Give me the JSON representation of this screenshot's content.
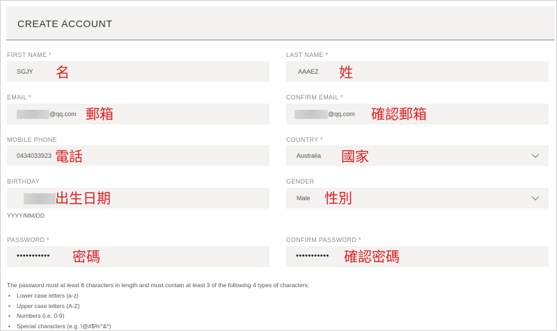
{
  "header": {
    "title": "CREATE ACCOUNT"
  },
  "fields": {
    "first_name": {
      "label": "FIRST NAME *",
      "value": "SGJY",
      "annotation": "名"
    },
    "last_name": {
      "label": "LAST NAME *",
      "value": "AAAEZ",
      "annotation": "姓"
    },
    "email": {
      "label": "EMAIL *",
      "value_suffix": "@qq.com",
      "annotation": "郵箱"
    },
    "confirm_email": {
      "label": "CONFIRM EMAIL *",
      "value_suffix": "@qq.com",
      "annotation": "確認郵箱"
    },
    "mobile_phone": {
      "label": "MOBILE PHONE",
      "value": "0434033923",
      "annotation": "電話"
    },
    "country": {
      "label": "COUNTRY *",
      "value": "Australia",
      "annotation": "國家"
    },
    "birthday": {
      "label": "BIRTHDAY",
      "hint": "YYYY/MM/DD",
      "annotation": "出生日期"
    },
    "gender": {
      "label": "GENDER",
      "value": "Male",
      "annotation": "性別"
    },
    "password": {
      "label": "PASSWORD *",
      "masked": "•••••••••••",
      "annotation": "密碼"
    },
    "confirm_password": {
      "label": "CONFIRM PASSWORD *",
      "masked": "•••••••••••",
      "annotation": "確認密碼"
    }
  },
  "password_rules": {
    "intro": "The password must at least 8 characters in length and must contain at least 3 of the following 4 types of characters:",
    "items": [
      "Lower case letters (a-z)",
      "Upper case letters (A-Z)",
      "Numbers (i.e. 0-9)",
      "Special characters (e.g. !@#$%^&*)"
    ]
  },
  "icons": {
    "select_arrow": "chevron-down-icon"
  },
  "colors": {
    "annotation": "#e21e1e",
    "field_bg": "#f3f2f1",
    "label": "#8c8c8c"
  }
}
